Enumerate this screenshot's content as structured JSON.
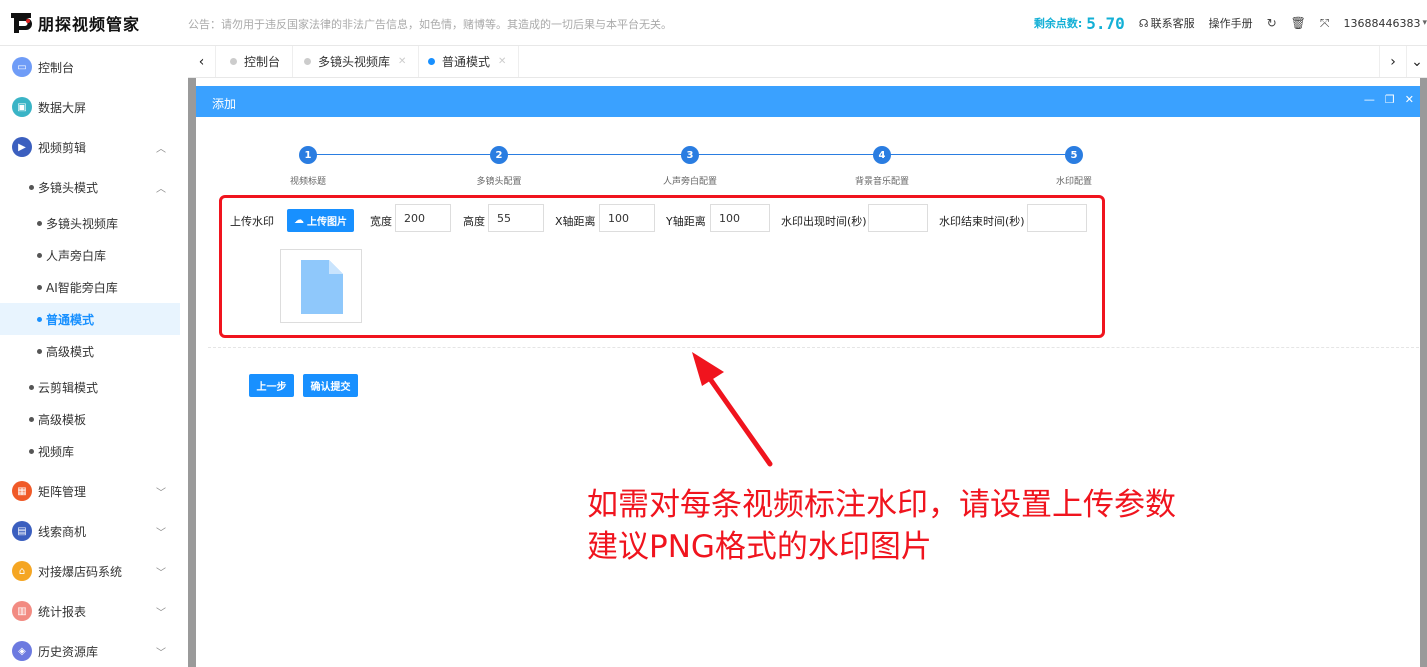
{
  "header": {
    "logo_text": "朋探视频管家",
    "notice": "公告：请勿用于违反国家法律的非法广告信息，如色情，赌博等。其造成的一切后果与本平台无关。",
    "points_label": "剩余点数:",
    "points_value": "5.70",
    "support": "联系客服",
    "manual": "操作手册",
    "user": "13688446383"
  },
  "sidebar": {
    "items": [
      {
        "label": "控制台",
        "icon": "monitor-icon",
        "color": "#6f9cf7"
      },
      {
        "label": "数据大屏",
        "icon": "screen-icon",
        "color": "#3ab4c6"
      },
      {
        "label": "视频剪辑",
        "icon": "video-edit-icon",
        "color": "#3b5fbf"
      },
      {
        "label": "多镜头模式"
      },
      {
        "label": "多镜头视频库"
      },
      {
        "label": "人声旁白库"
      },
      {
        "label": "AI智能旁白库"
      },
      {
        "label": "普通模式"
      },
      {
        "label": "高级模式"
      },
      {
        "label": "云剪辑模式"
      },
      {
        "label": "高级模板"
      },
      {
        "label": "视频库"
      },
      {
        "label": "矩阵管理",
        "icon": "grid-icon",
        "color": "#f05a28"
      },
      {
        "label": "线索商机",
        "icon": "chart-icon",
        "color": "#3b5fbf"
      },
      {
        "label": "对接爆店码系统",
        "icon": "store-icon",
        "color": "#f5a623"
      },
      {
        "label": "统计报表",
        "icon": "bar-chart-icon",
        "color": "#f28b82"
      },
      {
        "label": "历史资源库",
        "icon": "layers-icon",
        "color": "#6c7ae0"
      }
    ]
  },
  "tabs": [
    {
      "label": "控制台"
    },
    {
      "label": "多镜头视频库"
    },
    {
      "label": "普通模式"
    }
  ],
  "modal": {
    "title": "添加",
    "steps": [
      {
        "num": "1",
        "label": "视频标题"
      },
      {
        "num": "2",
        "label": "多镜头配置"
      },
      {
        "num": "3",
        "label": "人声旁白配置"
      },
      {
        "num": "4",
        "label": "背景音乐配置"
      },
      {
        "num": "5",
        "label": "水印配置"
      }
    ],
    "form": {
      "upload_label": "上传水印",
      "upload_button": "上传图片",
      "width_label": "宽度",
      "width_value": "200",
      "height_label": "高度",
      "height_value": "55",
      "x_label": "X轴距离",
      "x_value": "100",
      "y_label": "Y轴距离",
      "y_value": "100",
      "start_label": "水印出现时间(秒)",
      "start_value": "",
      "end_label": "水印结束时间(秒)",
      "end_value": ""
    },
    "prev_button": "上一步",
    "submit_button": "确认提交"
  },
  "annotation": {
    "line1": "如需对每条视频标注水印，请设置上传参数",
    "line2": "建议PNG格式的水印图片",
    "color": "#f0141e"
  }
}
